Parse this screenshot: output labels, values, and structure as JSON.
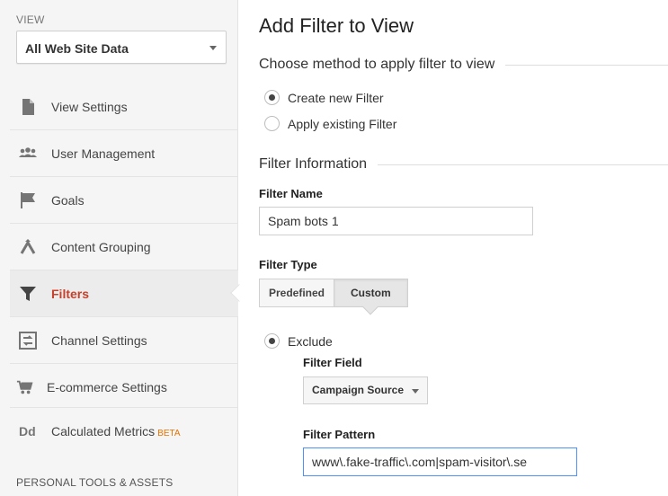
{
  "sidebar": {
    "view_label": "VIEW",
    "view_selected": "All Web Site Data",
    "items": [
      {
        "label": "View Settings",
        "icon": "document-icon"
      },
      {
        "label": "User Management",
        "icon": "users-icon"
      },
      {
        "label": "Goals",
        "icon": "flag-icon"
      },
      {
        "label": "Content Grouping",
        "icon": "content-grouping-icon"
      },
      {
        "label": "Filters",
        "icon": "filter-icon",
        "active": true
      },
      {
        "label": "Channel Settings",
        "icon": "channel-settings-icon"
      },
      {
        "label": "E-commerce Settings",
        "icon": "cart-icon"
      },
      {
        "label": "Calculated Metrics",
        "icon": "dd-icon",
        "badge": "BETA",
        "icon_text": "Dd"
      }
    ],
    "personal_heading": "PERSONAL TOOLS & ASSETS"
  },
  "main": {
    "title": "Add Filter to View",
    "method_heading": "Choose method to apply filter to view",
    "method_options": [
      "Create new Filter",
      "Apply existing Filter"
    ],
    "method_selected": 0,
    "info_heading": "Filter Information",
    "filter_name_label": "Filter Name",
    "filter_name_value": "Spam bots 1",
    "filter_type_label": "Filter Type",
    "filter_type_tabs": [
      "Predefined",
      "Custom"
    ],
    "filter_type_selected": 1,
    "exclude_label": "Exclude",
    "filter_field_label": "Filter Field",
    "filter_field_value": "Campaign Source",
    "filter_pattern_label": "Filter Pattern",
    "filter_pattern_value": "www\\.fake-traffic\\.com|spam-visitor\\.se"
  },
  "colors": {
    "active_nav": "#c6402a",
    "beta": "#e37400",
    "focus_border": "#4d90fe",
    "sidebar_bg": "#f5f5f5"
  }
}
